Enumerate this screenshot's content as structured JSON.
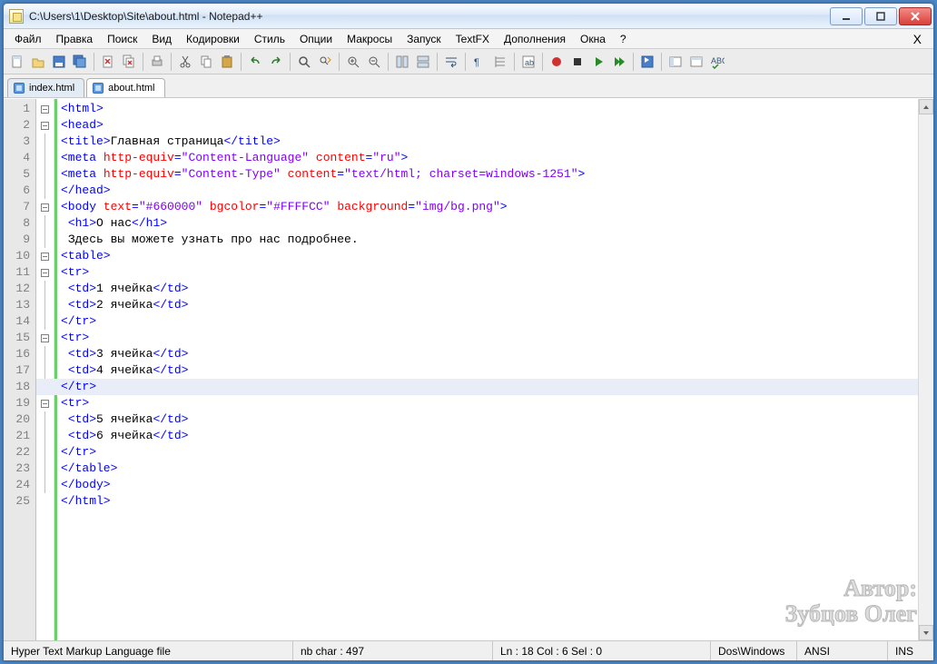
{
  "title": "C:\\Users\\1\\Desktop\\Site\\about.html - Notepad++",
  "menu": [
    "Файл",
    "Правка",
    "Поиск",
    "Вид",
    "Кодировки",
    "Стиль",
    "Опции",
    "Макросы",
    "Запуск",
    "TextFX",
    "Дополнения",
    "Окна",
    "?"
  ],
  "tabs": [
    {
      "label": "index.html",
      "active": false
    },
    {
      "label": "about.html",
      "active": true
    }
  ],
  "highlight_line": 18,
  "code": [
    {
      "n": 1,
      "fold": "box",
      "segs": [
        {
          "c": "k-tag",
          "t": "<html>"
        }
      ]
    },
    {
      "n": 2,
      "fold": "box",
      "segs": [
        {
          "c": "k-tag",
          "t": "<head>"
        }
      ]
    },
    {
      "n": 3,
      "fold": "line",
      "segs": [
        {
          "c": "k-tag",
          "t": "<title>"
        },
        {
          "c": "k-text",
          "t": "Главная страница"
        },
        {
          "c": "k-tag",
          "t": "</title>"
        }
      ]
    },
    {
      "n": 4,
      "fold": "line",
      "segs": [
        {
          "c": "k-tag",
          "t": "<meta "
        },
        {
          "c": "k-attr",
          "t": "http-equiv"
        },
        {
          "c": "k-tag",
          "t": "="
        },
        {
          "c": "k-str",
          "t": "\"Content-Language\""
        },
        {
          "c": "k-tag",
          "t": " "
        },
        {
          "c": "k-attr",
          "t": "content"
        },
        {
          "c": "k-tag",
          "t": "="
        },
        {
          "c": "k-str",
          "t": "\"ru\""
        },
        {
          "c": "k-tag",
          "t": ">"
        }
      ]
    },
    {
      "n": 5,
      "fold": "line",
      "segs": [
        {
          "c": "k-tag",
          "t": "<meta "
        },
        {
          "c": "k-attr",
          "t": "http-equiv"
        },
        {
          "c": "k-tag",
          "t": "="
        },
        {
          "c": "k-str",
          "t": "\"Content-Type\""
        },
        {
          "c": "k-tag",
          "t": " "
        },
        {
          "c": "k-attr",
          "t": "content"
        },
        {
          "c": "k-tag",
          "t": "="
        },
        {
          "c": "k-str",
          "t": "\"text/html; charset=windows-1251\""
        },
        {
          "c": "k-tag",
          "t": ">"
        }
      ]
    },
    {
      "n": 6,
      "fold": "line",
      "segs": [
        {
          "c": "k-tag",
          "t": "</head>"
        }
      ]
    },
    {
      "n": 7,
      "fold": "box",
      "segs": [
        {
          "c": "k-tag",
          "t": "<body "
        },
        {
          "c": "k-attr",
          "t": "text"
        },
        {
          "c": "k-tag",
          "t": "="
        },
        {
          "c": "k-str",
          "t": "\"#660000\""
        },
        {
          "c": "k-tag",
          "t": " "
        },
        {
          "c": "k-attr",
          "t": "bgcolor"
        },
        {
          "c": "k-tag",
          "t": "="
        },
        {
          "c": "k-str",
          "t": "\"#FFFFCC\""
        },
        {
          "c": "k-tag",
          "t": " "
        },
        {
          "c": "k-attr",
          "t": "background"
        },
        {
          "c": "k-tag",
          "t": "="
        },
        {
          "c": "k-str",
          "t": "\"img/bg.png\""
        },
        {
          "c": "k-tag",
          "t": ">"
        }
      ]
    },
    {
      "n": 8,
      "fold": "line",
      "indent": 1,
      "segs": [
        {
          "c": "k-tag",
          "t": "<h1>"
        },
        {
          "c": "k-text",
          "t": "О нас"
        },
        {
          "c": "k-tag",
          "t": "</h1>"
        }
      ]
    },
    {
      "n": 9,
      "fold": "line",
      "indent": 1,
      "segs": [
        {
          "c": "k-text",
          "t": "Здесь вы можете узнать про нас подробнее."
        }
      ]
    },
    {
      "n": 10,
      "fold": "box",
      "segs": [
        {
          "c": "k-tag",
          "t": "<table>"
        }
      ]
    },
    {
      "n": 11,
      "fold": "box",
      "segs": [
        {
          "c": "k-tag",
          "t": "<tr>"
        }
      ]
    },
    {
      "n": 12,
      "fold": "line",
      "indent": 1,
      "segs": [
        {
          "c": "k-tag",
          "t": "<td>"
        },
        {
          "c": "k-text",
          "t": "1 ячейка"
        },
        {
          "c": "k-tag",
          "t": "</td>"
        }
      ]
    },
    {
      "n": 13,
      "fold": "line",
      "indent": 1,
      "segs": [
        {
          "c": "k-tag",
          "t": "<td>"
        },
        {
          "c": "k-text",
          "t": "2 ячейка"
        },
        {
          "c": "k-tag",
          "t": "</td>"
        }
      ]
    },
    {
      "n": 14,
      "fold": "line",
      "segs": [
        {
          "c": "k-tag",
          "t": "</tr>"
        }
      ]
    },
    {
      "n": 15,
      "fold": "box",
      "segs": [
        {
          "c": "k-tag",
          "t": "<tr>"
        }
      ]
    },
    {
      "n": 16,
      "fold": "line",
      "indent": 1,
      "segs": [
        {
          "c": "k-tag",
          "t": "<td>"
        },
        {
          "c": "k-text",
          "t": "3 ячейка"
        },
        {
          "c": "k-tag",
          "t": "</td>"
        }
      ]
    },
    {
      "n": 17,
      "fold": "line",
      "indent": 1,
      "segs": [
        {
          "c": "k-tag",
          "t": "<td>"
        },
        {
          "c": "k-text",
          "t": "4 ячейка"
        },
        {
          "c": "k-tag",
          "t": "</td>"
        }
      ]
    },
    {
      "n": 18,
      "fold": "line",
      "segs": [
        {
          "c": "k-tag",
          "t": "</tr>"
        }
      ]
    },
    {
      "n": 19,
      "fold": "box",
      "segs": [
        {
          "c": "k-tag",
          "t": "<tr>"
        }
      ]
    },
    {
      "n": 20,
      "fold": "line",
      "indent": 1,
      "segs": [
        {
          "c": "k-tag",
          "t": "<td>"
        },
        {
          "c": "k-text",
          "t": "5 ячейка"
        },
        {
          "c": "k-tag",
          "t": "</td>"
        }
      ]
    },
    {
      "n": 21,
      "fold": "line",
      "indent": 1,
      "segs": [
        {
          "c": "k-tag",
          "t": "<td>"
        },
        {
          "c": "k-text",
          "t": "6 ячейка"
        },
        {
          "c": "k-tag",
          "t": "</td>"
        }
      ]
    },
    {
      "n": 22,
      "fold": "line",
      "segs": [
        {
          "c": "k-tag",
          "t": "</tr>"
        }
      ]
    },
    {
      "n": 23,
      "fold": "line",
      "segs": [
        {
          "c": "k-tag",
          "t": "</table>"
        }
      ]
    },
    {
      "n": 24,
      "fold": "line",
      "segs": [
        {
          "c": "k-tag",
          "t": "</body>"
        }
      ]
    },
    {
      "n": 25,
      "fold": "",
      "segs": [
        {
          "c": "k-tag",
          "t": "</html>"
        }
      ]
    }
  ],
  "status": {
    "filetype": "Hyper Text Markup Language file",
    "chars": "nb char : 497",
    "pos": "Ln : 18   Col : 6   Sel : 0",
    "eol": "Dos\\Windows",
    "enc": "ANSI",
    "ins": "INS"
  },
  "watermark": {
    "l1": "Автор:",
    "l2": "Зубцов Олег"
  },
  "toolbar_icons": [
    "new-file",
    "open-file",
    "save",
    "save-all",
    "sep",
    "close",
    "close-all",
    "sep",
    "print",
    "sep",
    "cut",
    "copy",
    "paste",
    "sep",
    "undo",
    "redo",
    "sep",
    "find",
    "replace",
    "sep",
    "zoom-in",
    "zoom-out",
    "sep",
    "sync-v",
    "sync-h",
    "sep",
    "wrap",
    "sep",
    "show-all",
    "indent-guide",
    "sep",
    "lang",
    "sep",
    "record",
    "stop",
    "play",
    "play-multi",
    "sep",
    "save-macro",
    "sep",
    "toggle-1",
    "toggle-2",
    "spellcheck"
  ]
}
